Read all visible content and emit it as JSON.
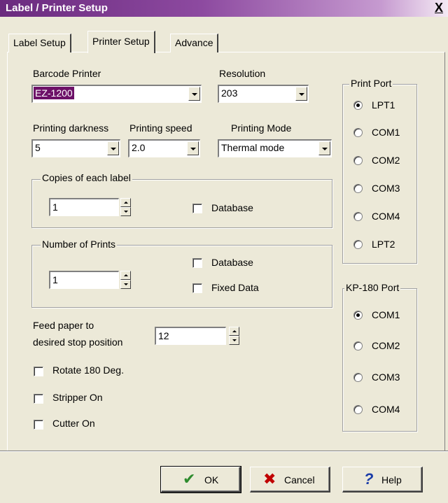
{
  "window": {
    "title": "Label / Printer Setup",
    "close_glyph": "X"
  },
  "tabs": [
    {
      "label": "Label Setup",
      "active": false
    },
    {
      "label": "Printer Setup",
      "active": true
    },
    {
      "label": "Advance",
      "active": false
    }
  ],
  "barcode_printer": {
    "label": "Barcode Printer",
    "value": "EZ-1200"
  },
  "resolution": {
    "label": "Resolution",
    "value": "203"
  },
  "printing_darkness": {
    "label": "Printing darkness",
    "value": "5"
  },
  "printing_speed": {
    "label": "Printing speed",
    "value": "2.0"
  },
  "printing_mode": {
    "label": "Printing Mode",
    "value": "Thermal mode"
  },
  "copies": {
    "label": "Copies of each label",
    "value": "1",
    "database_label": "Database",
    "database_checked": false
  },
  "prints": {
    "label": "Number of Prints",
    "value": "1",
    "database_label": "Database",
    "fixed_label": "Fixed Data"
  },
  "feed": {
    "label_line1": "Feed paper to",
    "label_line2": "desired stop position",
    "value": "12"
  },
  "options": {
    "rotate": "Rotate 180 Deg.",
    "stripper": "Stripper On",
    "cutter": "Cutter On"
  },
  "print_port": {
    "label": "Print Port",
    "items": [
      "LPT1",
      "COM1",
      "COM2",
      "COM3",
      "COM4",
      "LPT2"
    ],
    "selected": "LPT1"
  },
  "kp_port": {
    "label": "KP-180 Port",
    "items": [
      "COM1",
      "COM2",
      "COM3",
      "COM4"
    ],
    "selected": "COM1"
  },
  "buttons": {
    "ok": "OK",
    "cancel": "Cancel",
    "help": "Help"
  },
  "icons": {
    "ok": "checkmark-icon",
    "cancel": "x-icon",
    "help": "question-mark-icon"
  },
  "colors": {
    "title_bar": "#6a2a7e",
    "selection": "#6d1168",
    "ok_icon": "#2e8b2e",
    "cancel_icon": "#c00000",
    "help_icon": "#1a3ca8"
  }
}
